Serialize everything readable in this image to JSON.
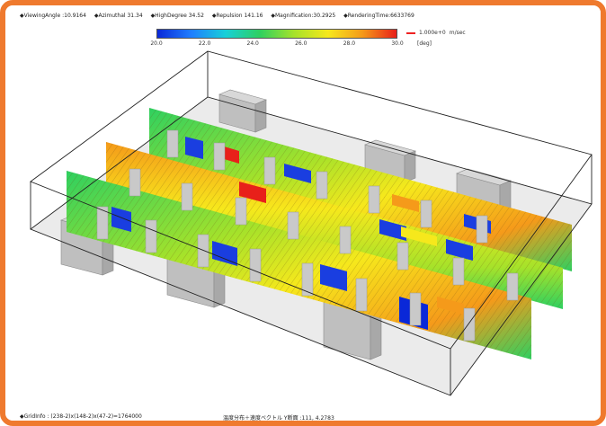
{
  "info_bar": {
    "viewing_angle": "◆ViewingAngle :10.9164",
    "azimuthal": "◆Azimuthal 31.34",
    "high_degree": "◆HighDegree 34.52",
    "repulsion": "◆Repulsion 141.16",
    "magnification": "◆Magnification:30.2925",
    "rendering_time": "◆RenderingTime:6633769"
  },
  "legend": {
    "ticks": [
      "20.0",
      "22.0",
      "24.0",
      "26.0",
      "28.0",
      "30.0"
    ],
    "unit": "[deg]",
    "reference_vector": "1.000e+0",
    "reference_unit": "m/sec",
    "colors": [
      "#0a28d8",
      "#1f7fff",
      "#18d0d8",
      "#2ed060",
      "#a6e22a",
      "#f6e81c",
      "#f59a1a",
      "#e8201a"
    ]
  },
  "status": {
    "grid_info": "◆GridInfo : (238-2)x(148-2)x(47-2)=1764000",
    "caption": "温度分布＋速度ベクトル Y断面 :111, 4.2783"
  }
}
